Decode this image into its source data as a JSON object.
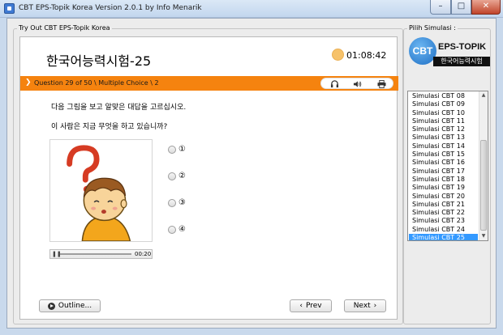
{
  "window": {
    "title": "CBT EPS-Topik Korea Version 2.0.1 by Info Menarik",
    "min_glyph": "–",
    "max_glyph": "□",
    "close_glyph": "✕"
  },
  "exam": {
    "group_label": "Try Out CBT EPS-Topik Korea",
    "title": "한국어능력시험-25",
    "timer": "01:08:42",
    "question_bar": "Question 29 of 50 \\ Multiple Choice \\ 2",
    "instruction": "다음 그림을 보고 알맞은 대답을 고르십시오.",
    "question": "이 사람은 지금 무엇을 하고 있습니까?",
    "options": [
      "①",
      "②",
      "③",
      "④"
    ],
    "audio": {
      "time": "00:20",
      "progress": 0.0
    },
    "buttons": {
      "outline": "Outline...",
      "prev": "Prev",
      "next": "Next"
    },
    "icons": [
      "headset-icon",
      "speaker-icon",
      "printer-icon"
    ]
  },
  "sidebar": {
    "group_label": "Pilih Simulasi :",
    "logo": {
      "circle_text": "CBT",
      "title": "EPS-TOPIK",
      "subtitle": "한국어능력시험"
    },
    "items": [
      "Simulasi CBT 08",
      "Simulasi CBT 09",
      "Simulasi CBT 10",
      "Simulasi CBT 11",
      "Simulasi CBT 12",
      "Simulasi CBT 13",
      "Simulasi CBT 14",
      "Simulasi CBT 15",
      "Simulasi CBT 16",
      "Simulasi CBT 17",
      "Simulasi CBT 18",
      "Simulasi CBT 19",
      "Simulasi CBT 20",
      "Simulasi CBT 21",
      "Simulasi CBT 22",
      "Simulasi CBT 23",
      "Simulasi CBT 24",
      "Simulasi CBT 25"
    ],
    "selected": "Simulasi CBT 25"
  },
  "colors": {
    "accent": "#f5830f",
    "selection": "#3399ff"
  }
}
